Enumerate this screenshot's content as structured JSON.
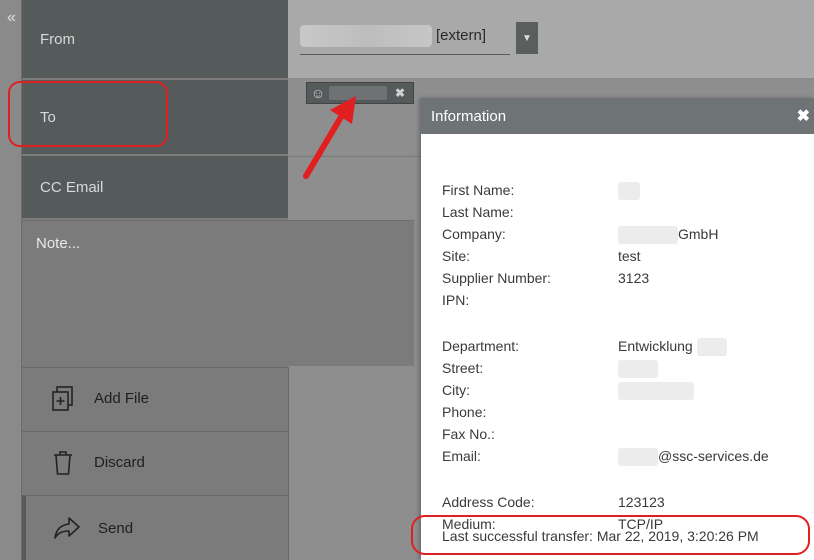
{
  "sidebar": {
    "collapse_icon": "«"
  },
  "fields": {
    "from_label": "From",
    "to_label": "To",
    "cc_label": "CC Email",
    "from_extern": "[extern]",
    "note_placeholder": "Note..."
  },
  "actions": {
    "add_file": "Add File",
    "discard": "Discard",
    "send": "Send"
  },
  "popup": {
    "title": "Information",
    "close": "✖",
    "rows": [
      {
        "key": "First Name:",
        "value": ""
      },
      {
        "key": "Last Name:",
        "value": ""
      },
      {
        "key": "Company:",
        "value": "GmbH"
      },
      {
        "key": "Site:",
        "value": "test"
      },
      {
        "key": "Supplier Number:",
        "value": "3123"
      },
      {
        "key": "IPN:",
        "value": ""
      },
      {
        "key": "Department:",
        "value": "Entwicklung"
      },
      {
        "key": "Street:",
        "value": ""
      },
      {
        "key": "City:",
        "value": ""
      },
      {
        "key": "Phone:",
        "value": ""
      },
      {
        "key": "Fax No.:",
        "value": ""
      },
      {
        "key": "Email:",
        "value": "@ssc-services.de"
      },
      {
        "key": "Address Code:",
        "value": "123123"
      },
      {
        "key": "Medium:",
        "value": "TCP/IP"
      }
    ],
    "last_transfer": "Last successful transfer: Mar 22, 2019, 3:20:26 PM"
  },
  "colors": {
    "highlight": "#e02020",
    "panel_dark": "#555a5b",
    "popup_header": "#6e7375"
  }
}
